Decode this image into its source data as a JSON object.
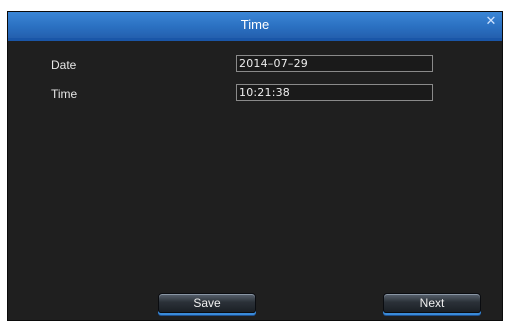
{
  "dialog": {
    "title": "Time",
    "close_glyph": "✕"
  },
  "form": {
    "date_label": "Date",
    "date_value": "2014–07–29",
    "time_label": "Time",
    "time_value": "10:21:38"
  },
  "buttons": {
    "save_label": "Save",
    "next_label": "Next"
  },
  "colors": {
    "titlebar": "#2a6fc0",
    "background": "#1f1f1f",
    "button_accent": "#3a8ad8"
  },
  "icons": {
    "close": "close-icon"
  }
}
